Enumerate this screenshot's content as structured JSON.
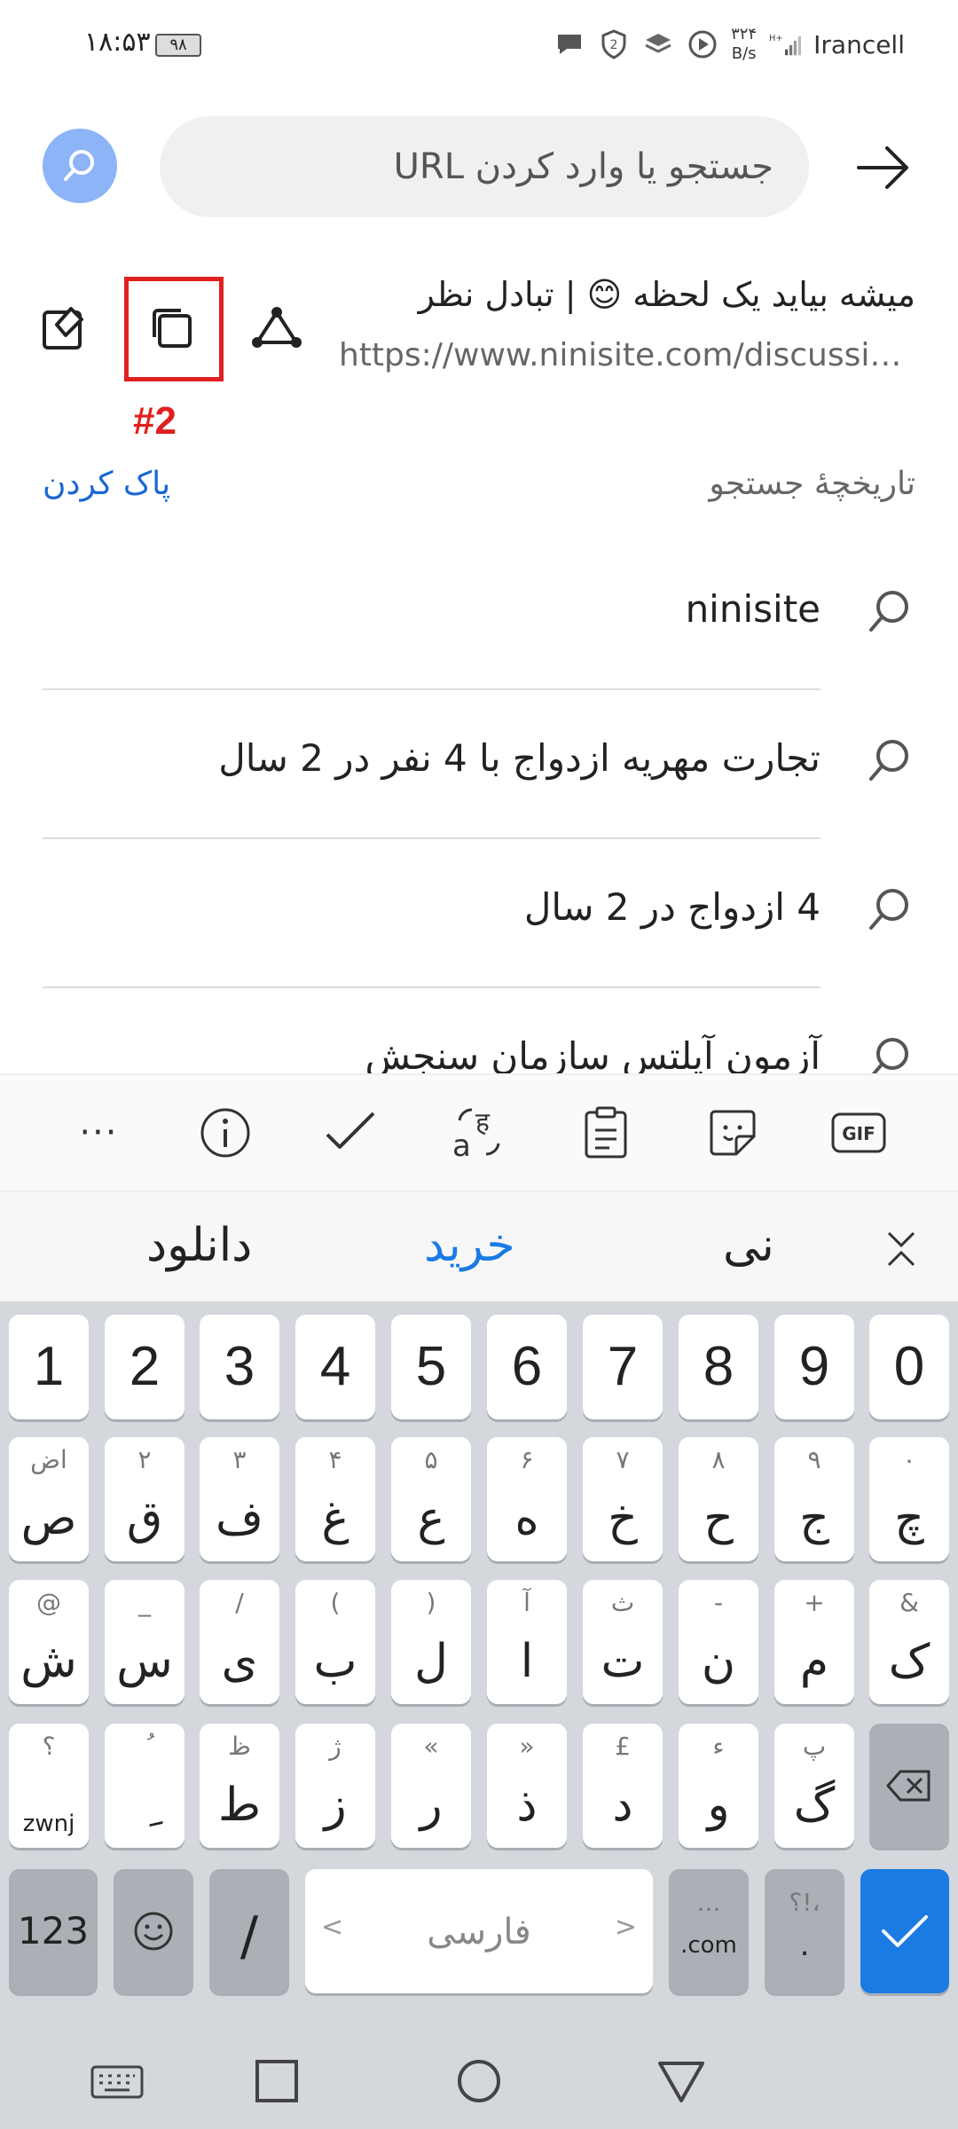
{
  "status_bar": {
    "time": "۱۸:۵۳",
    "battery": "۹۸",
    "speed_value": "۳۲۴",
    "speed_unit": "B/s",
    "network": "H+",
    "carrier": "Irancell"
  },
  "url_bar": {
    "placeholder": "جستجو یا وارد کردن URL"
  },
  "page_suggestion": {
    "title": "میشه بیاید یک لحظه 😊 | تبادل نظر",
    "url": "https://www.ninisite.com/discussion"
  },
  "annotation": {
    "marker": "#2",
    "color": "#e02020"
  },
  "history": {
    "title": "تاریخچهٔ جستجو",
    "clear_label": "پاک کردن",
    "items": [
      "ninisite",
      "تجارت مهریه ازدواج با 4 نفر در 2 سال",
      "4 ازدواج در 2 سال",
      "آزمون آیلتس سازمان سنجش"
    ]
  },
  "keyboard_toolbar": {
    "icons": [
      "more-icon",
      "info-icon",
      "checkmark-icon",
      "translate-icon",
      "clipboard-icon",
      "sticker-icon",
      "gif-icon"
    ],
    "gif_label": "GIF",
    "more_label": "···"
  },
  "suggestions": {
    "words": [
      "دانلود",
      "خرید",
      "نی"
    ]
  },
  "keyboard": {
    "number_row": [
      "1",
      "2",
      "3",
      "4",
      "5",
      "6",
      "7",
      "8",
      "9",
      "0"
    ],
    "row1": [
      {
        "main": "ص",
        "sub": "اض"
      },
      {
        "main": "ق",
        "sub": "۲"
      },
      {
        "main": "ف",
        "sub": "۳"
      },
      {
        "main": "غ",
        "sub": "۴"
      },
      {
        "main": "ع",
        "sub": "۵"
      },
      {
        "main": "ه",
        "sub": "۶"
      },
      {
        "main": "خ",
        "sub": "۷"
      },
      {
        "main": "ح",
        "sub": "۸"
      },
      {
        "main": "ج",
        "sub": "۹"
      },
      {
        "main": "چ",
        "sub": "۰"
      }
    ],
    "row2": [
      {
        "main": "ش",
        "sub": "@"
      },
      {
        "main": "س",
        "sub": "_"
      },
      {
        "main": "ی",
        "sub": "/"
      },
      {
        "main": "ب",
        "sub": "("
      },
      {
        "main": "ل",
        "sub": ")"
      },
      {
        "main": "ا",
        "sub": "آ"
      },
      {
        "main": "ت",
        "sub": "ث"
      },
      {
        "main": "ن",
        "sub": "-"
      },
      {
        "main": "م",
        "sub": "+"
      },
      {
        "main": "ک",
        "sub": "&"
      }
    ],
    "row3": [
      {
        "main": "zwnj",
        "sub": "؟"
      },
      {
        "main": "ِ",
        "sub": "ُ"
      },
      {
        "main": "ط",
        "sub": "ظ"
      },
      {
        "main": "ز",
        "sub": "ژ"
      },
      {
        "main": "ر",
        "sub": "«"
      },
      {
        "main": "ذ",
        "sub": "»"
      },
      {
        "main": "د",
        "sub": "£"
      },
      {
        "main": "و",
        "sub": "ء"
      },
      {
        "main": "گ",
        "sub": "پ"
      }
    ],
    "num_switch": "123",
    "slash": "/",
    "space_label": "فارسی",
    "space_left": "<",
    "space_right": ">",
    "com_label": ".com",
    "com_sub": "...",
    "period_label": ".",
    "period_sub": "؟!،"
  },
  "colors": {
    "accent": "#1a7be3",
    "search_button": "#8cb4f7",
    "clear_link": "#1a66d6"
  }
}
